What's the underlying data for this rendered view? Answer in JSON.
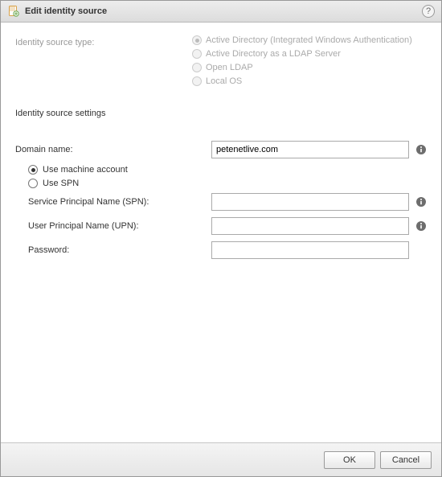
{
  "dialog": {
    "title": "Edit identity source"
  },
  "source_type": {
    "label": "Identity source type:",
    "options": {
      "ad_iwa": "Active Directory (Integrated Windows Authentication)",
      "ad_ldap": "Active Directory as a LDAP Server",
      "open_ldap": "Open LDAP",
      "local_os": "Local OS"
    },
    "selected": "ad_iwa"
  },
  "settings": {
    "header": "Identity source settings",
    "domain_name": {
      "label": "Domain name:",
      "value": "petenetlive.com"
    },
    "account_mode": {
      "use_machine": "Use machine account",
      "use_spn": "Use SPN",
      "selected": "use_machine"
    },
    "spn_section": {
      "spn_label": "Service Principal Name (SPN):",
      "spn_value": "",
      "upn_label": "User Principal Name (UPN):",
      "upn_value": "",
      "password_label": "Password:",
      "password_value": ""
    }
  },
  "buttons": {
    "ok": "OK",
    "cancel": "Cancel"
  }
}
